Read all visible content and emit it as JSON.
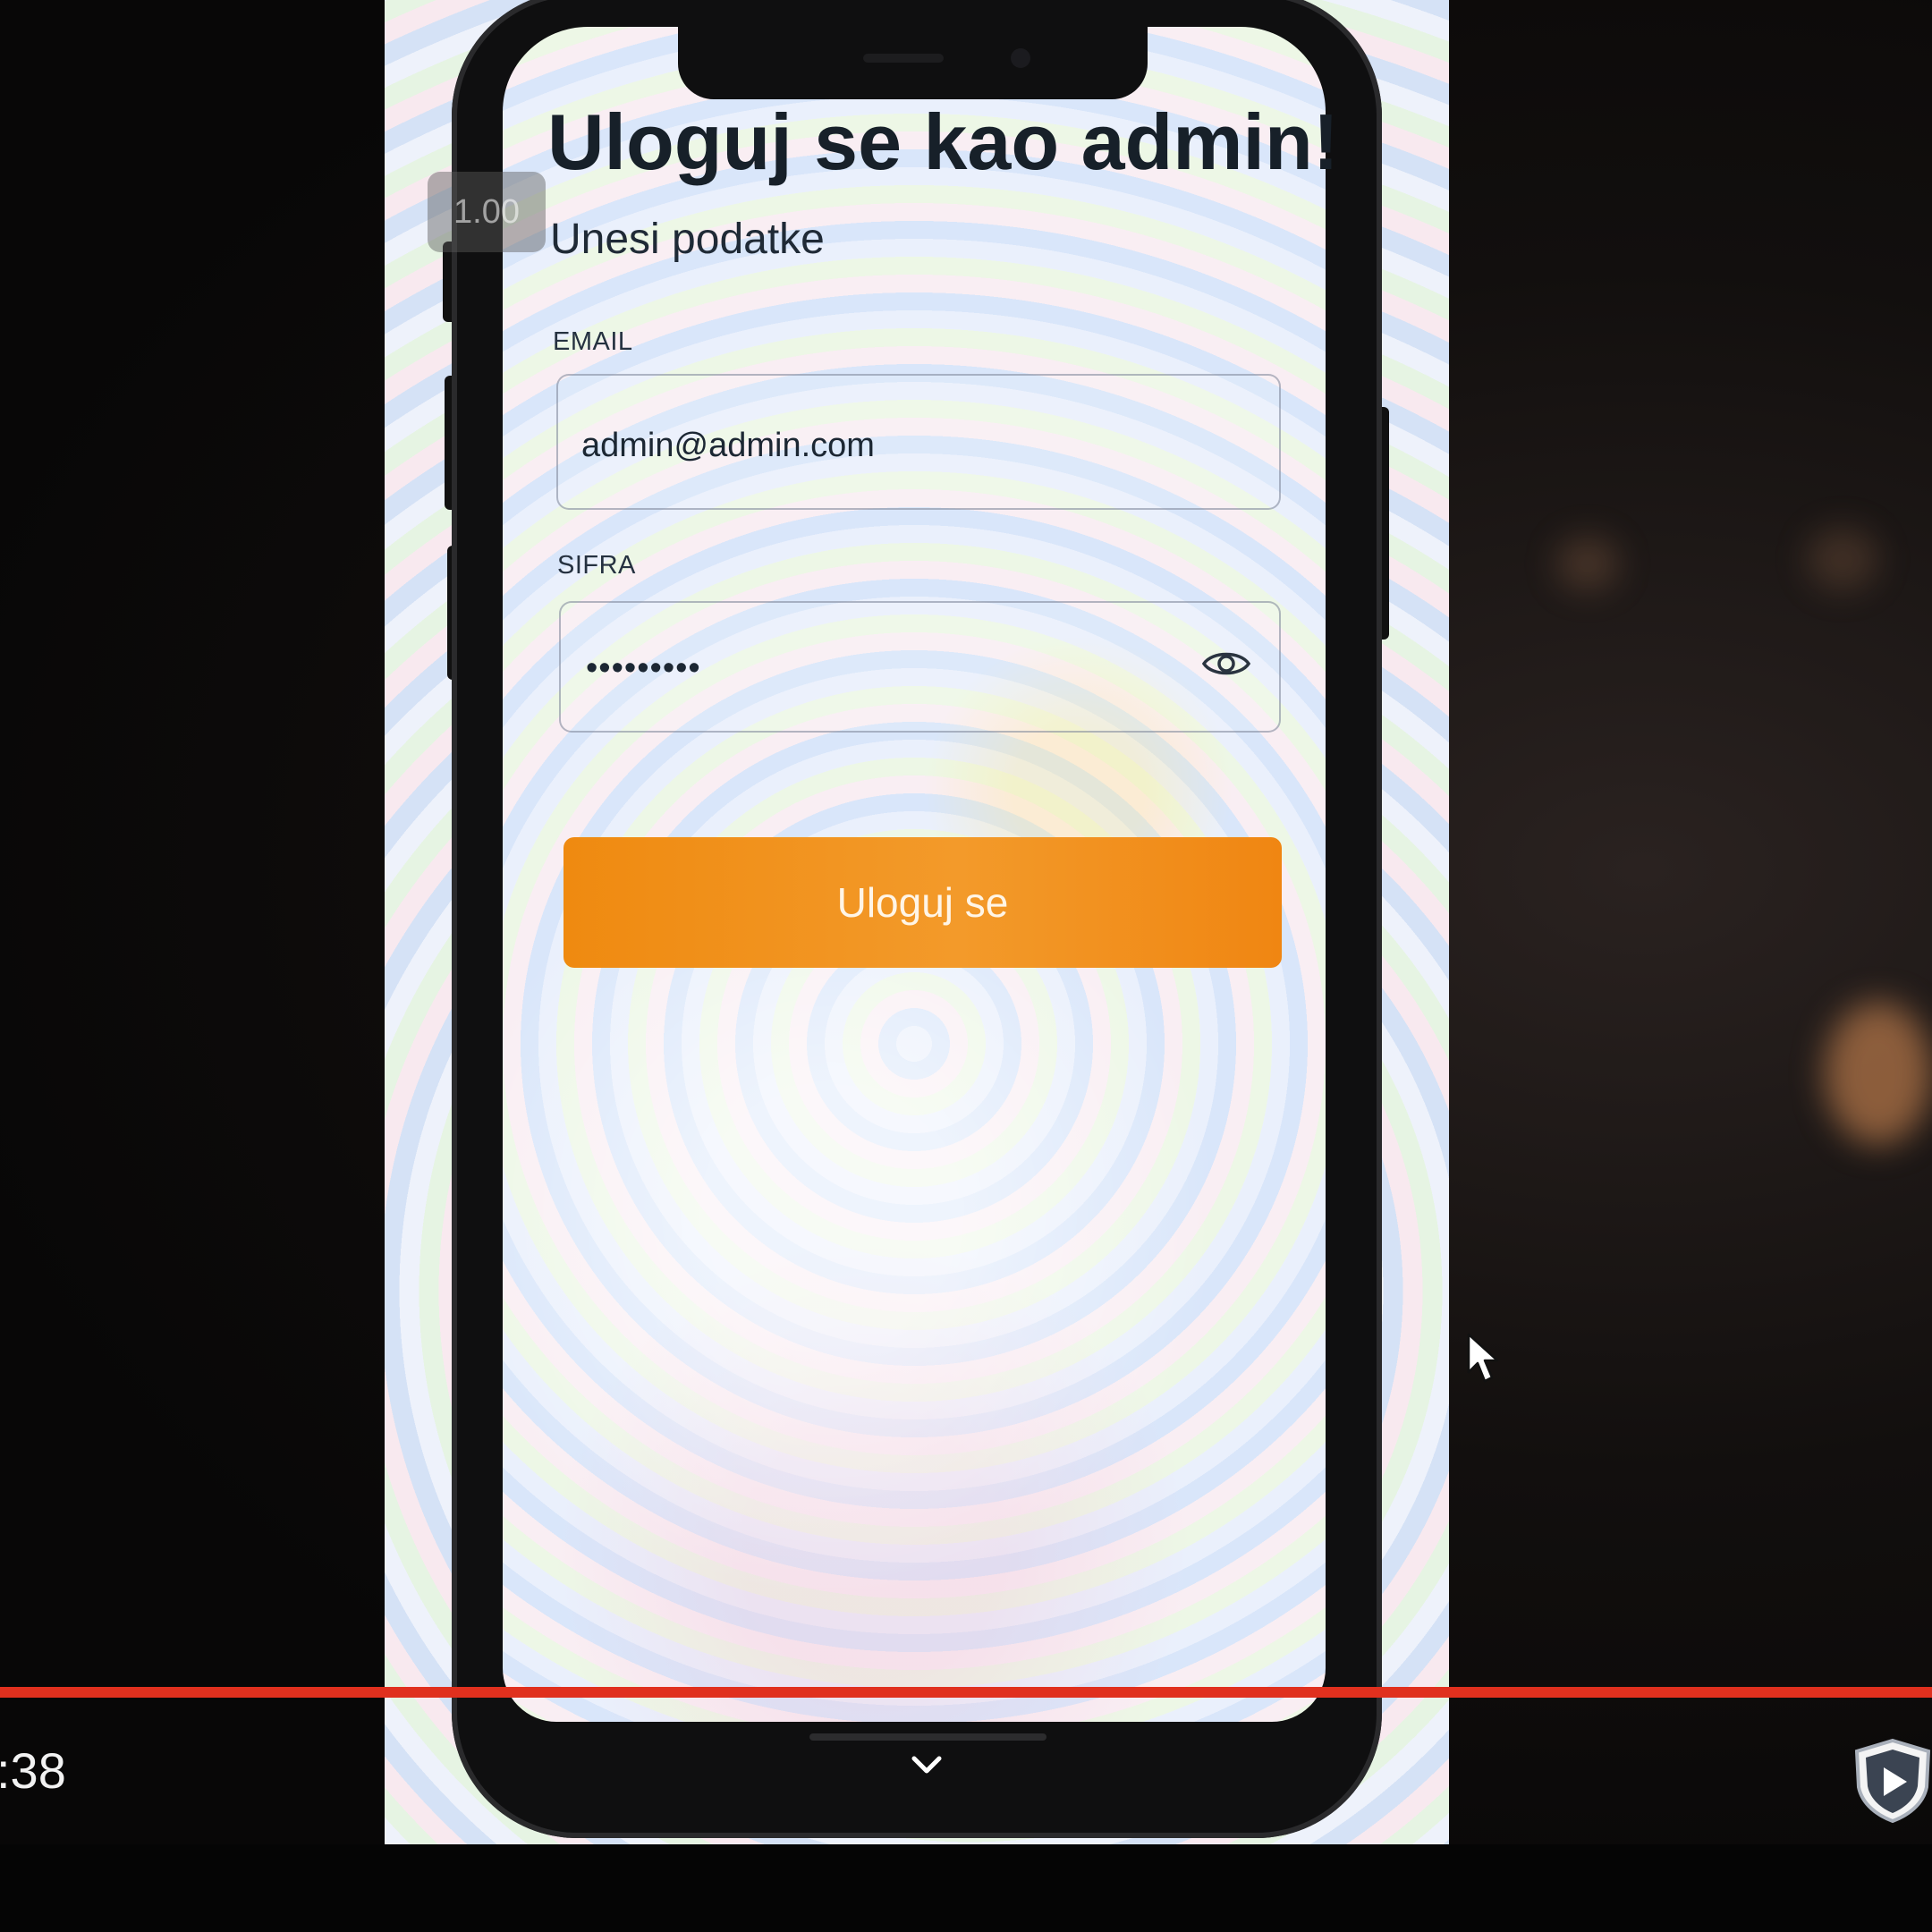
{
  "player": {
    "speed_label": "1.00",
    "time_label": ":38",
    "progress_color": "#e0301e"
  },
  "login": {
    "title": "Uloguj se kao admin!",
    "subtitle": "Unesi podatke",
    "email_label": "EMAIL",
    "email_value": "admin@admin.com",
    "password_label": "SIFRA",
    "password_value": "•••••••••",
    "password_toggle_icon": "eye-icon",
    "submit_label": "Uloguj se",
    "accent_color": "#f08a12"
  },
  "icons": {
    "home_chevron": "chevron-down-icon",
    "player_badge": "shield-play-icon",
    "pointer": "cursor-icon"
  }
}
